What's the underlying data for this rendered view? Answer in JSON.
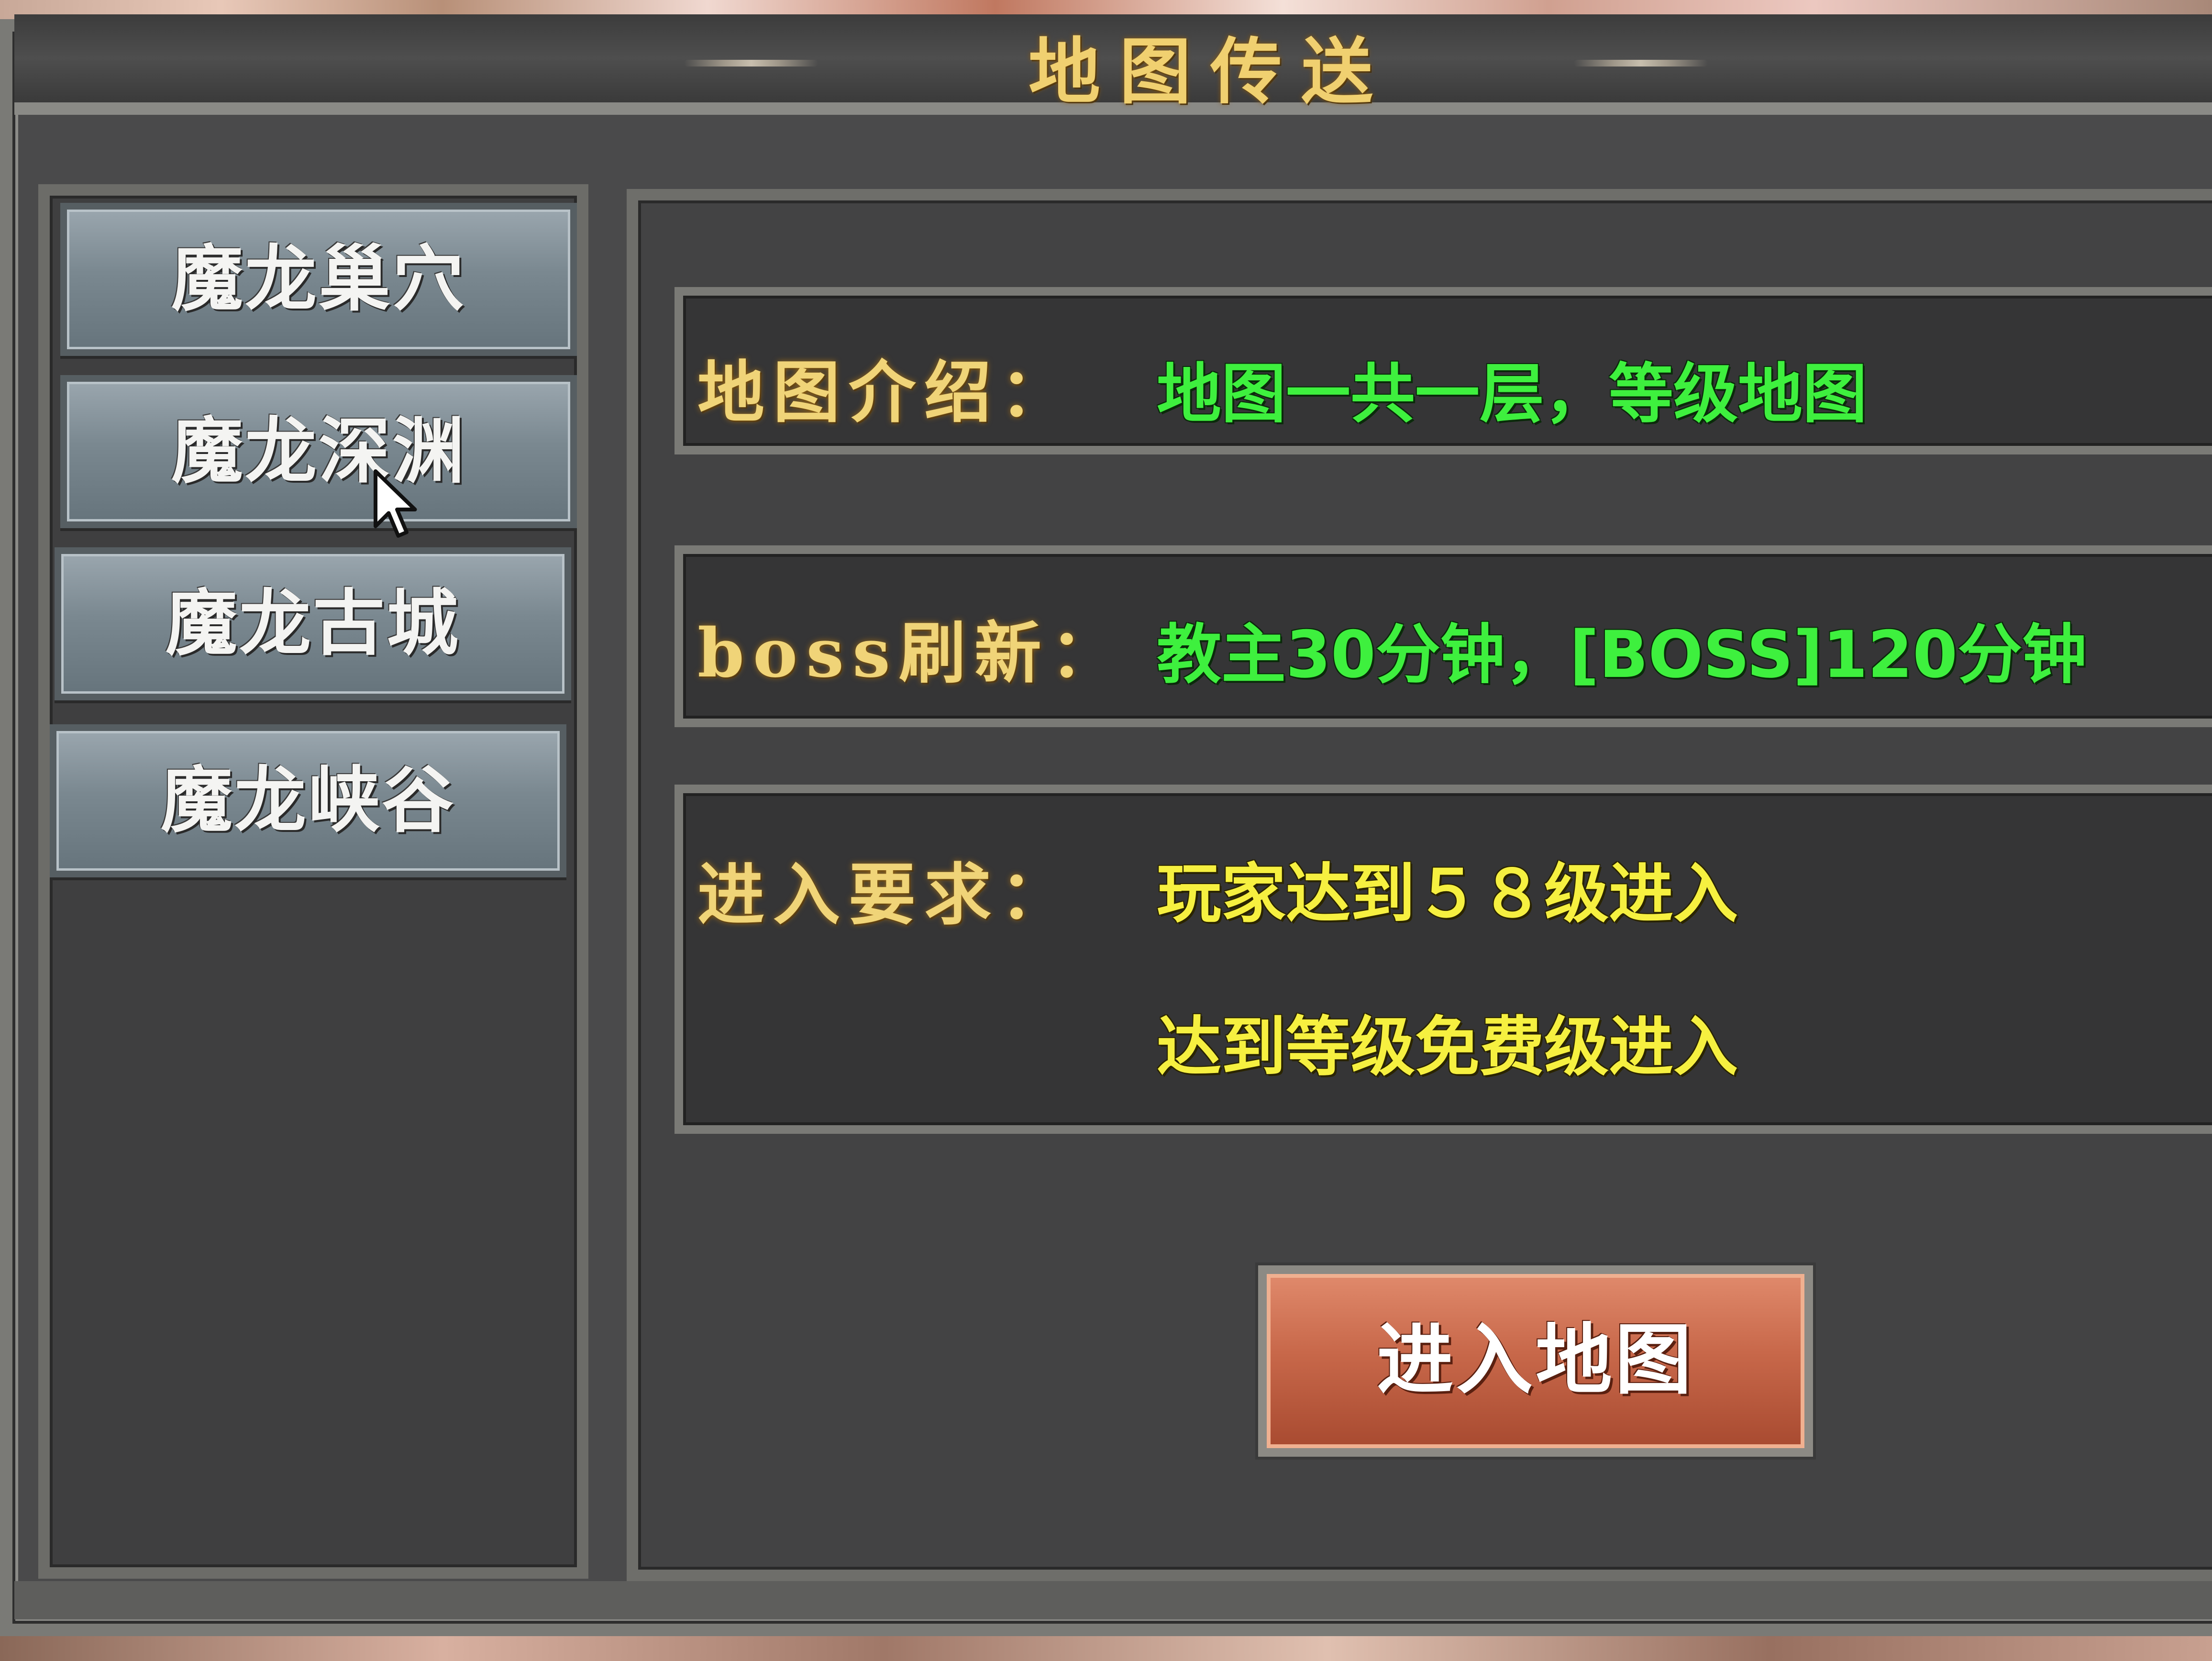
{
  "window": {
    "title": "地图传送"
  },
  "map_list": {
    "items": [
      {
        "label": "魔龙巢穴"
      },
      {
        "label": "魔龙深渊"
      },
      {
        "label": "魔龙古城"
      },
      {
        "label": "魔龙峡谷"
      }
    ],
    "hovered_index": 1
  },
  "details": {
    "intro_label": "地图介绍：",
    "intro_value": "地图一共一层，等级地图",
    "boss_label": "boss刷新：",
    "boss_value": "教主30分钟，[BOSS]120分钟",
    "requirement_label": "进入要求：",
    "requirement_line1": "玩家达到５８级进入",
    "requirement_line2": "达到等级免费级进入"
  },
  "actions": {
    "enter_label": "进入地图"
  },
  "colors": {
    "gold_label": "#f0d478",
    "green_value": "#3ef03e",
    "yellow_value": "#f6f040",
    "enter_button": "#c8684a"
  },
  "icons": [
    "mouse-pointer-icon"
  ]
}
